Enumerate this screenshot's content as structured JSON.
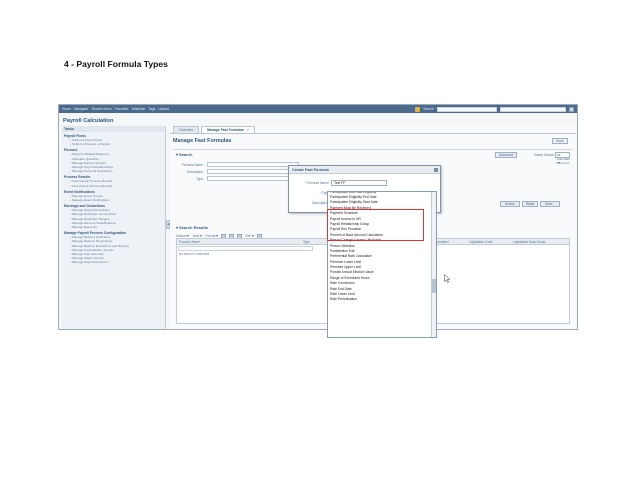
{
  "doc": {
    "heading": "4 - Payroll Formula Types"
  },
  "topbar": {
    "items": [
      "Home",
      "Navigator",
      "Recent Items",
      "Favorites",
      "Watchlist",
      "Tags",
      "Upload"
    ],
    "search_label": "Search"
  },
  "app": {
    "title": "Payroll Calculation"
  },
  "tasks": {
    "header": "Tasks",
    "groups": [
      {
        "title": "Payroll Flows",
        "items": [
          "Submit a Payroll Flow",
          "Submit a Process or Report"
        ]
      },
      {
        "title": "Persons",
        "items": [
          "Payroll Individual Balances",
          "Calculate QuickPay",
          "Manage Element Entries",
          "Manage Payroll Relationships",
          "Manage Personal Deductions"
        ]
      },
      {
        "title": "Process Results",
        "items": [
          "View Payroll Process Results",
          "View Person Process Results"
        ]
      },
      {
        "title": "Event Notifications",
        "items": [
          "Manage Event Groups",
          "Manage Event Notifications"
        ]
      },
      {
        "title": "Earnings and Deductions",
        "items": [
          "Manage Payroll Deductions",
          "Manage Deduction Group Rules",
          "Manage Deduction Ranges",
          "Manage Element Classifications",
          "Manage Elements"
        ]
      },
      {
        "title": "Manage Payroll Process Configuration",
        "items": [
          "Manage Balance Definitions",
          "Manage Balance Dimensions",
          "Manage Balance Exceptions and Reports",
          "Manage Consolidation Groups",
          "Manage Fast Formulas",
          "Manage Object Groups",
          "Manage Payroll Definitions"
        ]
      }
    ]
  },
  "main": {
    "tabs": [
      {
        "label": "Overview"
      },
      {
        "label": "Manage Fast Formulas"
      }
    ],
    "page_title": "Manage Fast Formulas",
    "done_label": "Done",
    "search": {
      "title": "Search",
      "advanced_label": "Advanced",
      "saved_search_label": "Saved Search",
      "saved_search_value": "All Formulas",
      "required_note": "* Required",
      "fields": [
        {
          "label": "Formula Name"
        },
        {
          "label": "Description"
        },
        {
          "label": "Type"
        }
      ],
      "buttons": [
        "Search",
        "Reset",
        "Save..."
      ]
    },
    "results": {
      "title": "Search Results",
      "toolbar": [
        "Actions",
        "View",
        "Format",
        "Edit"
      ],
      "columns": [
        "Formula Name",
        "Type",
        "Compiled",
        "Legislative Code",
        "Legislative Data Group"
      ],
      "empty_text": "No search conducted."
    }
  },
  "modal": {
    "title": "Create Fast Formula",
    "formula_name_label": "* Formula Name",
    "formula_name_value": "Test FF",
    "type_label": "* Type",
    "description_label": "Description"
  },
  "dropdown": {
    "options": [
      "Participation and Rate Eligibility",
      "Participation Eligibility End Date",
      "Participation Eligibility Start Date",
      "Payment Must Be Received",
      "Payment Schedule",
      "Payroll Access to HR",
      "Payroll Relationship Group",
      "Payroll Run Proration",
      "Percent of Base Amount Calculation",
      "Person Change Causes Life Event",
      "Person Selection",
      "Postelection Edit",
      "Preferential Rate Calculation",
      "Premium Lower Limit",
      "Premium Upper Limit",
      "Prorate Annual Election Value",
      "Range of Scheduled Hours",
      "Rate Conversion",
      "Rate End Date",
      "Rate Lower Limit",
      "Rate Periodization"
    ]
  }
}
